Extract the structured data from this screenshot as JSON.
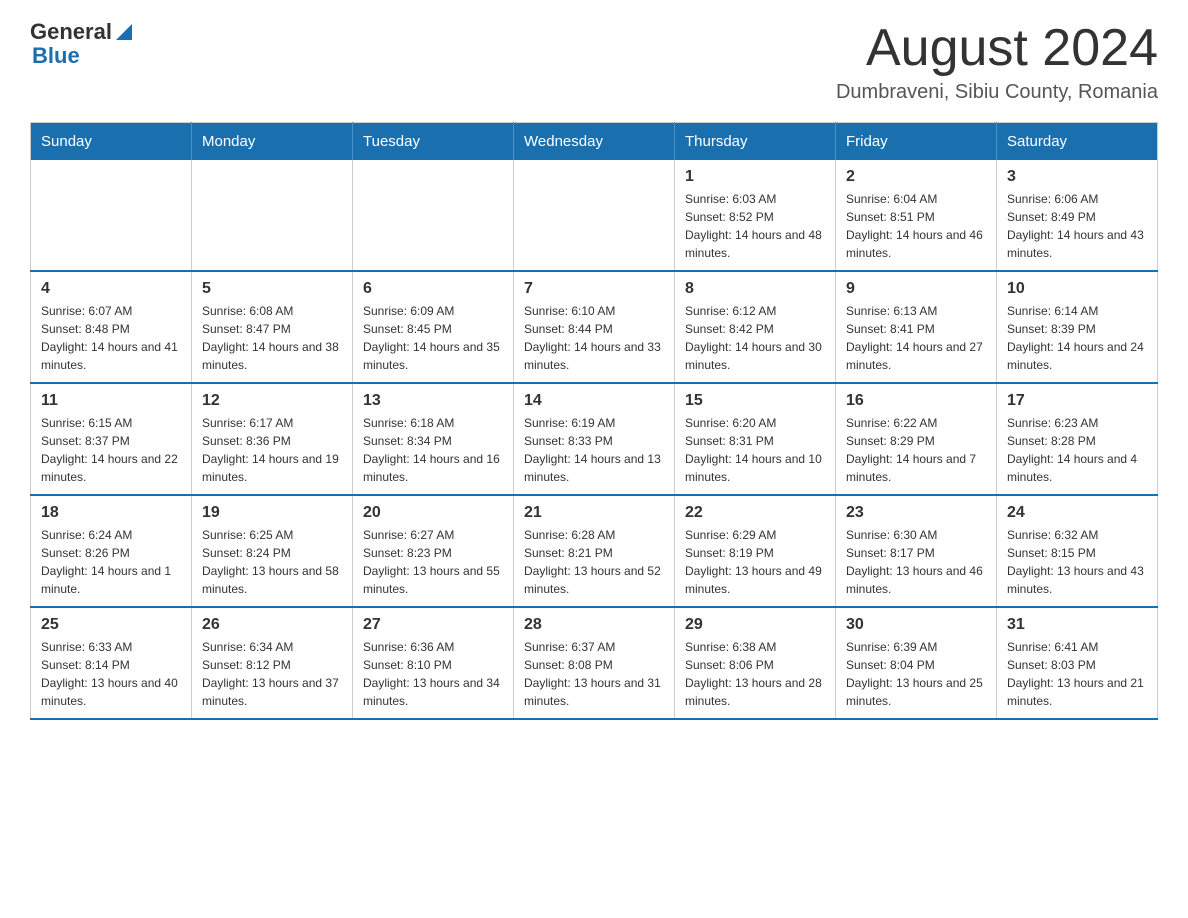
{
  "header": {
    "logo_general": "General",
    "logo_blue": "Blue",
    "month_title": "August 2024",
    "location": "Dumbraveni, Sibiu County, Romania"
  },
  "days_of_week": [
    "Sunday",
    "Monday",
    "Tuesday",
    "Wednesday",
    "Thursday",
    "Friday",
    "Saturday"
  ],
  "weeks": [
    [
      {
        "day": "",
        "info": ""
      },
      {
        "day": "",
        "info": ""
      },
      {
        "day": "",
        "info": ""
      },
      {
        "day": "",
        "info": ""
      },
      {
        "day": "1",
        "info": "Sunrise: 6:03 AM\nSunset: 8:52 PM\nDaylight: 14 hours and 48 minutes."
      },
      {
        "day": "2",
        "info": "Sunrise: 6:04 AM\nSunset: 8:51 PM\nDaylight: 14 hours and 46 minutes."
      },
      {
        "day": "3",
        "info": "Sunrise: 6:06 AM\nSunset: 8:49 PM\nDaylight: 14 hours and 43 minutes."
      }
    ],
    [
      {
        "day": "4",
        "info": "Sunrise: 6:07 AM\nSunset: 8:48 PM\nDaylight: 14 hours and 41 minutes."
      },
      {
        "day": "5",
        "info": "Sunrise: 6:08 AM\nSunset: 8:47 PM\nDaylight: 14 hours and 38 minutes."
      },
      {
        "day": "6",
        "info": "Sunrise: 6:09 AM\nSunset: 8:45 PM\nDaylight: 14 hours and 35 minutes."
      },
      {
        "day": "7",
        "info": "Sunrise: 6:10 AM\nSunset: 8:44 PM\nDaylight: 14 hours and 33 minutes."
      },
      {
        "day": "8",
        "info": "Sunrise: 6:12 AM\nSunset: 8:42 PM\nDaylight: 14 hours and 30 minutes."
      },
      {
        "day": "9",
        "info": "Sunrise: 6:13 AM\nSunset: 8:41 PM\nDaylight: 14 hours and 27 minutes."
      },
      {
        "day": "10",
        "info": "Sunrise: 6:14 AM\nSunset: 8:39 PM\nDaylight: 14 hours and 24 minutes."
      }
    ],
    [
      {
        "day": "11",
        "info": "Sunrise: 6:15 AM\nSunset: 8:37 PM\nDaylight: 14 hours and 22 minutes."
      },
      {
        "day": "12",
        "info": "Sunrise: 6:17 AM\nSunset: 8:36 PM\nDaylight: 14 hours and 19 minutes."
      },
      {
        "day": "13",
        "info": "Sunrise: 6:18 AM\nSunset: 8:34 PM\nDaylight: 14 hours and 16 minutes."
      },
      {
        "day": "14",
        "info": "Sunrise: 6:19 AM\nSunset: 8:33 PM\nDaylight: 14 hours and 13 minutes."
      },
      {
        "day": "15",
        "info": "Sunrise: 6:20 AM\nSunset: 8:31 PM\nDaylight: 14 hours and 10 minutes."
      },
      {
        "day": "16",
        "info": "Sunrise: 6:22 AM\nSunset: 8:29 PM\nDaylight: 14 hours and 7 minutes."
      },
      {
        "day": "17",
        "info": "Sunrise: 6:23 AM\nSunset: 8:28 PM\nDaylight: 14 hours and 4 minutes."
      }
    ],
    [
      {
        "day": "18",
        "info": "Sunrise: 6:24 AM\nSunset: 8:26 PM\nDaylight: 14 hours and 1 minute."
      },
      {
        "day": "19",
        "info": "Sunrise: 6:25 AM\nSunset: 8:24 PM\nDaylight: 13 hours and 58 minutes."
      },
      {
        "day": "20",
        "info": "Sunrise: 6:27 AM\nSunset: 8:23 PM\nDaylight: 13 hours and 55 minutes."
      },
      {
        "day": "21",
        "info": "Sunrise: 6:28 AM\nSunset: 8:21 PM\nDaylight: 13 hours and 52 minutes."
      },
      {
        "day": "22",
        "info": "Sunrise: 6:29 AM\nSunset: 8:19 PM\nDaylight: 13 hours and 49 minutes."
      },
      {
        "day": "23",
        "info": "Sunrise: 6:30 AM\nSunset: 8:17 PM\nDaylight: 13 hours and 46 minutes."
      },
      {
        "day": "24",
        "info": "Sunrise: 6:32 AM\nSunset: 8:15 PM\nDaylight: 13 hours and 43 minutes."
      }
    ],
    [
      {
        "day": "25",
        "info": "Sunrise: 6:33 AM\nSunset: 8:14 PM\nDaylight: 13 hours and 40 minutes."
      },
      {
        "day": "26",
        "info": "Sunrise: 6:34 AM\nSunset: 8:12 PM\nDaylight: 13 hours and 37 minutes."
      },
      {
        "day": "27",
        "info": "Sunrise: 6:36 AM\nSunset: 8:10 PM\nDaylight: 13 hours and 34 minutes."
      },
      {
        "day": "28",
        "info": "Sunrise: 6:37 AM\nSunset: 8:08 PM\nDaylight: 13 hours and 31 minutes."
      },
      {
        "day": "29",
        "info": "Sunrise: 6:38 AM\nSunset: 8:06 PM\nDaylight: 13 hours and 28 minutes."
      },
      {
        "day": "30",
        "info": "Sunrise: 6:39 AM\nSunset: 8:04 PM\nDaylight: 13 hours and 25 minutes."
      },
      {
        "day": "31",
        "info": "Sunrise: 6:41 AM\nSunset: 8:03 PM\nDaylight: 13 hours and 21 minutes."
      }
    ]
  ]
}
